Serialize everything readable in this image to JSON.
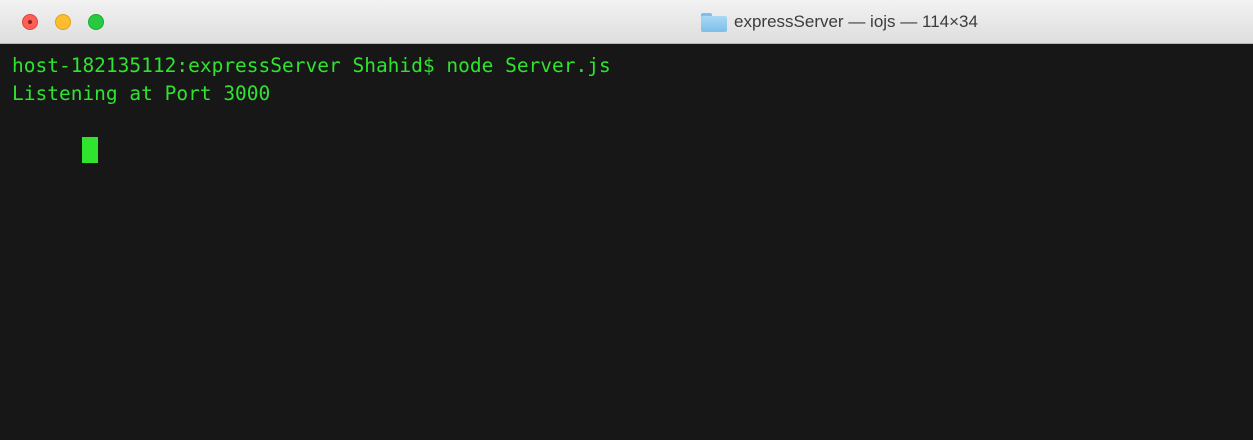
{
  "window": {
    "title": "expressServer — iojs — 114×34",
    "title_icon": "folder-icon",
    "traffic_lights": [
      {
        "name": "close",
        "color": "#fd5f57"
      },
      {
        "name": "minimize",
        "color": "#febc2e"
      },
      {
        "name": "zoom",
        "color": "#28c940"
      }
    ]
  },
  "terminal": {
    "background": "#171717",
    "text_color": "#2fe32f",
    "lines": [
      "host-182135112:expressServer Shahid$ node Server.js",
      "Listening at Port 3000"
    ]
  }
}
